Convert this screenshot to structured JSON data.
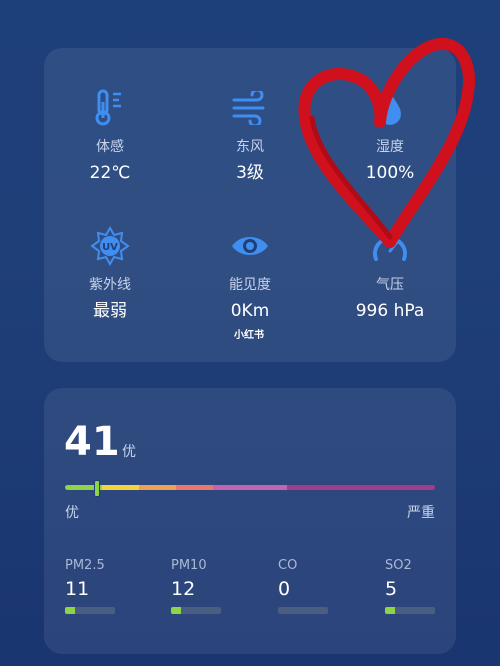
{
  "weather": {
    "metrics": [
      {
        "label": "体感",
        "value": "22℃",
        "icon": "thermometer-icon"
      },
      {
        "label": "东风",
        "value": "3级",
        "icon": "wind-icon"
      },
      {
        "label": "湿度",
        "value": "100%",
        "icon": "humidity-drop-icon"
      },
      {
        "label": "紫外线",
        "value": "最弱",
        "icon": "uv-sun-icon"
      },
      {
        "label": "能见度",
        "value": "0Km",
        "icon": "eye-icon"
      },
      {
        "label": "气压",
        "value": "996 hPa",
        "icon": "pressure-gauge-icon"
      }
    ],
    "watermark": "小红书"
  },
  "aqi": {
    "value": "41",
    "level": "优",
    "scale_low": "优",
    "scale_high": "严重",
    "marker_fraction": 0.083,
    "scale_colors": [
      "#8dd545",
      "#f5d13a",
      "#f0a050",
      "#e9776a",
      "#c463b0",
      "#a23c8d"
    ],
    "pollutants": [
      {
        "name": "PM2.5",
        "value": "11",
        "fill": 0.2
      },
      {
        "name": "PM10",
        "value": "12",
        "fill": 0.2
      },
      {
        "name": "CO",
        "value": "0",
        "fill": 0.0
      },
      {
        "name": "SO2",
        "value": "5",
        "fill": 0.2
      }
    ]
  },
  "colors": {
    "accent_icon": "#3f8ef0",
    "good": "#8dd545",
    "annotation_heart": "#d0101c"
  }
}
